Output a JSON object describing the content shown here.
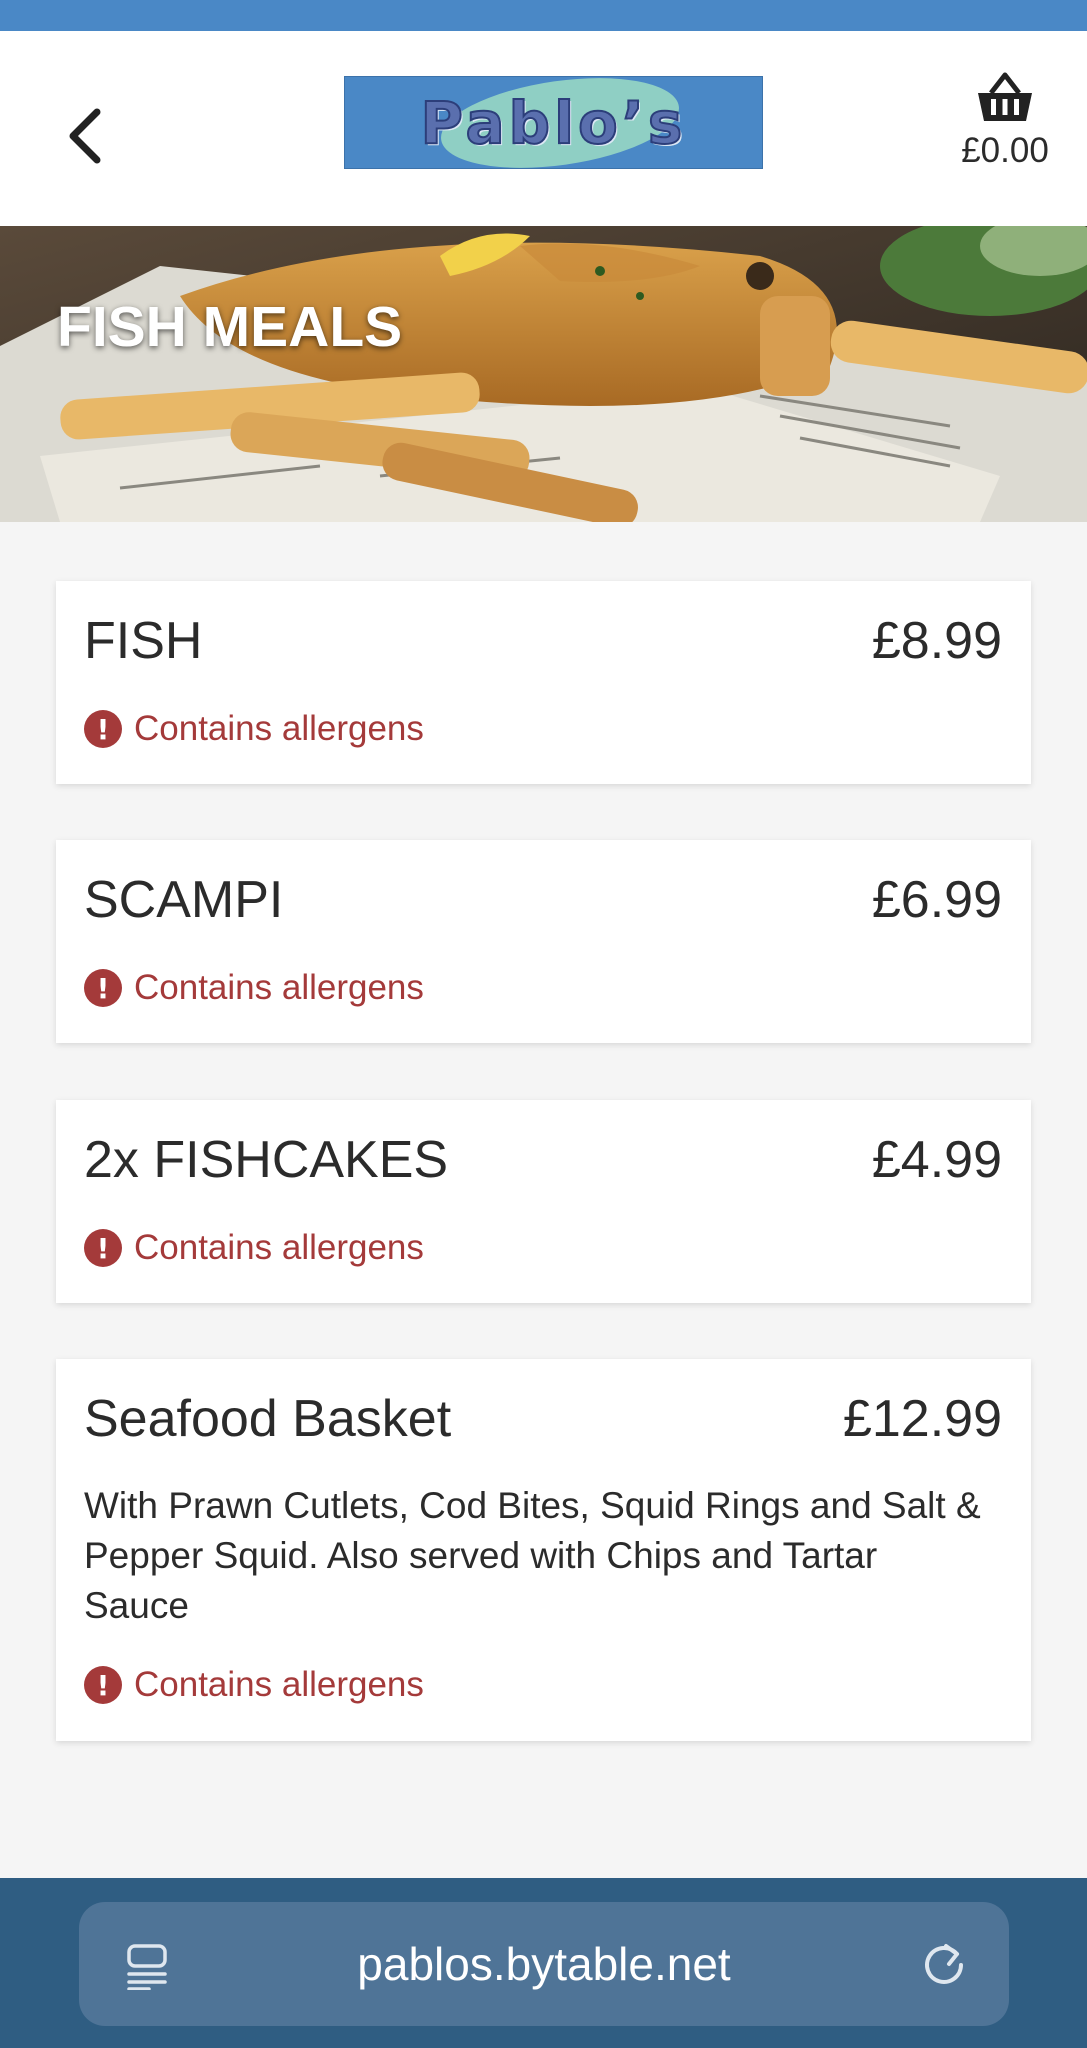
{
  "header": {
    "back_icon": "chevron-left-icon",
    "logo_text": "Pablo’s",
    "cart_icon": "basket-icon",
    "cart_total": "£0.00"
  },
  "category": {
    "title": "FISH MEALS"
  },
  "menu_items": [
    {
      "name": "FISH",
      "price": "£8.99",
      "description": "",
      "allergen_label": "Contains allergens"
    },
    {
      "name": "SCAMPI",
      "price": "£6.99",
      "description": "",
      "allergen_label": "Contains allergens"
    },
    {
      "name": "2x FISHCAKES",
      "price": "£4.99",
      "description": "",
      "allergen_label": "Contains allergens"
    },
    {
      "name": "Seafood Basket",
      "price": "£12.99",
      "description": "With Prawn Cutlets, Cod Bites, Squid Rings and Salt & Pepper Squid. Also served with Chips and Tartar Sauce",
      "allergen_label": "Contains allergens"
    }
  ],
  "browser": {
    "url": "pablos.bytable.net",
    "tabs_icon": "reader-icon",
    "reload_icon": "reload-icon"
  },
  "colors": {
    "brand_blue": "#4a88c6",
    "allergen_red": "#a43a3a",
    "bottom_bar": "#2f5d82"
  }
}
